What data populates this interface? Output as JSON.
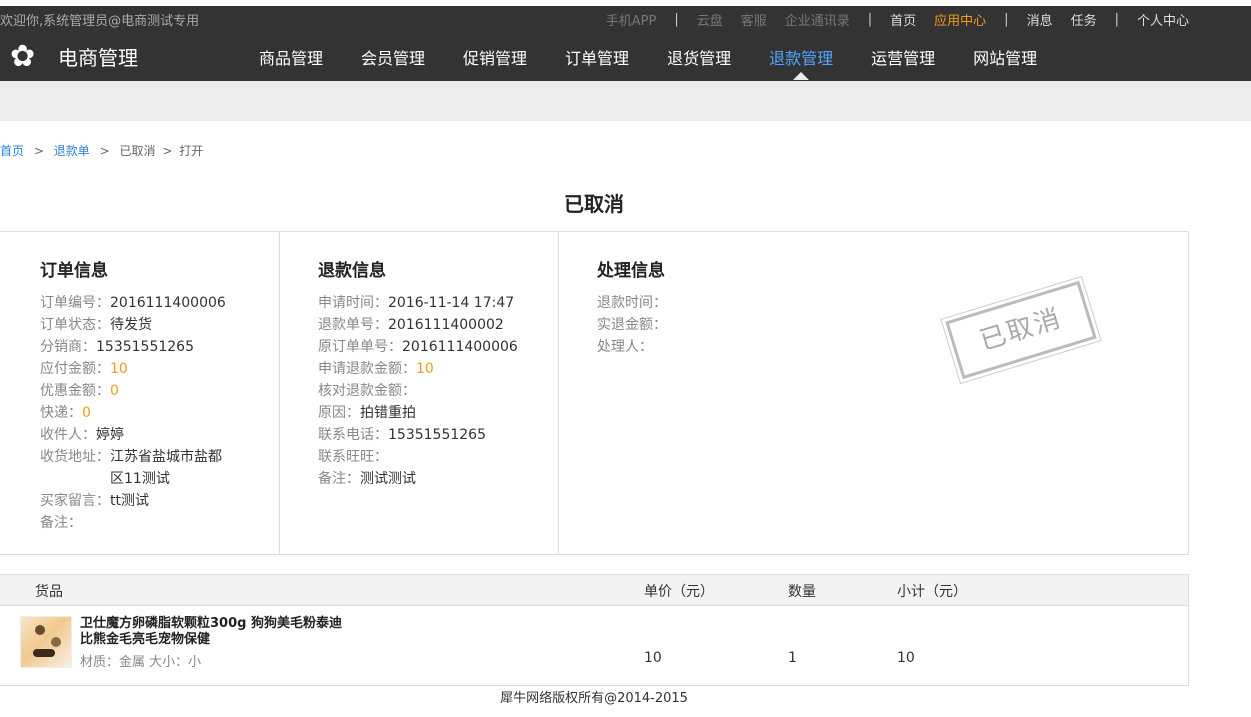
{
  "topbar": {
    "welcome": "欢迎你,系统管理员@电商测试专用",
    "links": [
      {
        "label": "手机APP",
        "style": "dim"
      },
      {
        "label": "|",
        "style": "sep"
      },
      {
        "label": "云盘",
        "style": "dim"
      },
      {
        "label": "客服",
        "style": "dim"
      },
      {
        "label": "企业通讯录",
        "style": "dim"
      },
      {
        "label": "|",
        "style": "sep"
      },
      {
        "label": "首页",
        "style": "light"
      },
      {
        "label": "应用中心",
        "style": "accent"
      },
      {
        "label": "|",
        "style": "sep"
      },
      {
        "label": "消息",
        "style": "light"
      },
      {
        "label": "任务",
        "style": "light"
      },
      {
        "label": "|",
        "style": "sep"
      },
      {
        "label": "个人中心",
        "style": "light"
      }
    ]
  },
  "logo": {
    "title": "电商管理",
    "icon": "flower-gear-icon"
  },
  "nav": {
    "items": [
      "商品管理",
      "会员管理",
      "促销管理",
      "订单管理",
      "退货管理",
      "退款管理",
      "运营管理",
      "网站管理"
    ],
    "active_index": 5
  },
  "breadcrumb": {
    "home": "首页",
    "refund": "退款单",
    "status": "已取消",
    "current": "打开",
    "sep": ">"
  },
  "status_title": "已取消",
  "order_info": {
    "title": "订单信息",
    "order_no_label": "订单编号：",
    "order_no": "2016111400006",
    "order_status_label": "订单状态：",
    "order_status": "待发货",
    "distributor_label": "分销商：",
    "distributor": "15351551265",
    "payable_label": "应付金额：",
    "payable": "10",
    "discount_label": "优惠金额：",
    "discount": "0",
    "express_label": "快递：",
    "express": "0",
    "receiver_label": "收件人：",
    "receiver": "婷婷",
    "address_label": "收货地址：",
    "address": "江苏省盐城市盐都区11测试",
    "buyer_msg_label": "买家留言：",
    "buyer_msg": "tt测试",
    "remark_label": "备注：",
    "remark": ""
  },
  "refund_info": {
    "title": "退款信息",
    "apply_time_label": "申请时间：",
    "apply_time": "2016-11-14 17:47",
    "refund_no_label": "退款单号：",
    "refund_no": "2016111400002",
    "orig_order_label": "原订单单号：",
    "orig_order": "2016111400006",
    "apply_amount_label": "申请退款金额：",
    "apply_amount": "10",
    "check_amount_label": "核对退款金额：",
    "check_amount": "",
    "reason_label": "原因：",
    "reason": "拍错重拍",
    "phone_label": "联系电话：",
    "phone": "15351551265",
    "wangwang_label": "联系旺旺：",
    "wangwang": "",
    "note_label": "备注：",
    "note": "测试测试"
  },
  "process_info": {
    "title": "处理信息",
    "refund_time_label": "退款时间：",
    "refund_time": "",
    "actual_amount_label": "实退金额：",
    "actual_amount": "",
    "handler_label": "处理人：",
    "handler": "",
    "stamp": "已取消"
  },
  "goods": {
    "headers": {
      "item": "货品",
      "price": "单价（元）",
      "qty": "数量",
      "subtotal": "小计（元）"
    },
    "rows": [
      {
        "name": "卫仕魔方卵磷脂软颗粒300g 狗狗美毛粉泰迪比熊金毛亮毛宠物保健",
        "spec": "材质：金属   大小：小",
        "price": "10",
        "qty": "1",
        "subtotal": "10",
        "thumb_icon": "product-thumbnail"
      }
    ]
  },
  "footer": "犀牛网络版权所有@2014-2015",
  "colors": {
    "topbar": "#333333",
    "accent": "#f29b1a",
    "active_nav": "#4fa6ff",
    "link": "#2f82d8"
  }
}
